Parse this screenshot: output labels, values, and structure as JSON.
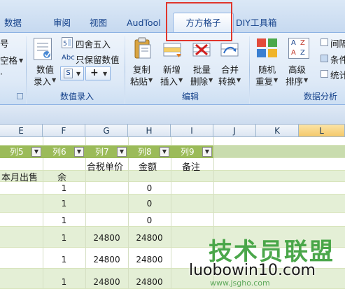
{
  "ribbon_tabs": [
    "数据",
    "审阅",
    "视图",
    "AudTool",
    "方方格子",
    "DIY工具箱"
  ],
  "active_tab": "方方格子",
  "left_cut_labels": [
    "号",
    "空格",
    "·"
  ],
  "value_entry_group": {
    "label": "数值录入",
    "big_button": {
      "line1": "数值",
      "line2": "录入"
    },
    "small_buttons": [
      "四舍五入",
      "只保留数值"
    ],
    "abc_prefix": "Abc",
    "symbol_button": "S",
    "plus_button": "+"
  },
  "edit_group": {
    "label": "编辑",
    "buttons": [
      {
        "line1": "复制",
        "line2": "粘贴"
      },
      {
        "line1": "新增",
        "line2": "插入"
      },
      {
        "line1": "批量",
        "line2": "删除"
      },
      {
        "line1": "合并",
        "line2": "转换"
      }
    ]
  },
  "analysis_group": {
    "label": "数据分析",
    "buttons": [
      {
        "line1": "随机",
        "line2": "重复"
      },
      {
        "line1": "高级",
        "line2": "排序"
      }
    ],
    "sort_icon_letters": [
      "A",
      "Z",
      "A",
      "Z"
    ],
    "side_items": [
      "间隔",
      "条件",
      "统计"
    ]
  },
  "column_headers": [
    "E",
    "F",
    "G",
    "H",
    "I",
    "J",
    "K",
    "L"
  ],
  "selected_column": "L",
  "filter_headers": [
    "列5",
    "列6",
    "列7",
    "列8",
    "列9"
  ],
  "header_row": {
    "e": "本月出售",
    "f": "余",
    "g": "合税单价",
    "h": "金额",
    "i": "备注"
  },
  "rows": [
    {
      "f": "1",
      "g": "",
      "h": "0"
    },
    {
      "f": "1",
      "g": "",
      "h": "0"
    },
    {
      "f": "1",
      "g": "",
      "h": "0"
    },
    {
      "f": "1",
      "g": "24800",
      "h": "24800"
    },
    {
      "f": "1",
      "g": "24800",
      "h": "24800"
    },
    {
      "f": "1",
      "g": "24800",
      "h": "24800"
    }
  ],
  "watermark": {
    "logo": "技术员联盟",
    "url": "luobowin10.com",
    "site": "www.jsgho.com"
  },
  "colors": {
    "ribbon_text": "#15428b",
    "highlight": "#e0362c",
    "filter_header": "#9bbb59",
    "sheet_band": "#e4efd6"
  }
}
